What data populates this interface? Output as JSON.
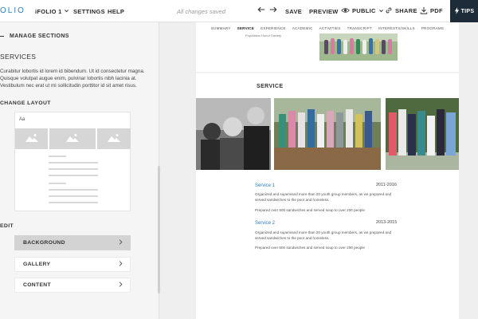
{
  "topbar": {
    "logo": "OLIO",
    "folio_label": "iFOLIO 1",
    "settings": "SETTINGS",
    "help": "HELP",
    "saved_status": "All changes saved",
    "save": "SAVE",
    "preview": "PREVIEW",
    "public": "PUBLIC",
    "share": "SHARE",
    "pdf": "PDF",
    "tips": "TIPS"
  },
  "sidebar": {
    "manage_sections": "MANAGE SECTIONS",
    "section_title": "SERVICES",
    "description": "Curabitur lobortis id lorem id bibendum. Ut id consectetur magna. Quisque volutpat augue enim, pulvinar lobortis nibh lacinia at. Vestibulum nec erat ut mi sollicitudin porttitor id sit amet risus.",
    "change_layout": "CHANGE LAYOUT",
    "layout_preview_label": "Aa",
    "edit_heading": "EDIT",
    "edit_items": [
      {
        "label": "BACKGROUND",
        "active": true
      },
      {
        "label": "GALLERY",
        "active": false
      },
      {
        "label": "CONTENT",
        "active": false
      }
    ]
  },
  "main": {
    "nav": [
      "SUMMARY",
      "SERVICE",
      "EXPERIENCE",
      "ACADEMIC",
      "ACTIVITIES",
      "TRANSCRIPT",
      "INTERESTS/SKILLS",
      "PROGRAMS"
    ],
    "nav_active": "SERVICE",
    "org_text": "Population Honor Society",
    "service_heading": "SERVICE",
    "entries": [
      {
        "title": "Service 1",
        "years": "2011-2016",
        "line1": "Organized and supervised more than 20 youth group members, as we prepared and served sandwiches to the poor and homeless.",
        "line2": "Prepared over 800 sandwiches and served soup to over 200 people"
      },
      {
        "title": "Service 2",
        "years": "2013-2015",
        "line1": "Organized and supervised more than 20 youth group members, as we prepared and served sandwiches to the poor and homeless.",
        "line2": "Prepared over 800 sandwiches and served soup to over 200 people"
      }
    ]
  },
  "colors": {
    "accent": "#2a7fc1",
    "tips_bg": "#1e2c3a",
    "active_button": "#d3d3d3"
  },
  "icons": [
    "chevron-down-icon",
    "arrow-left-icon",
    "arrow-right-icon",
    "eye-icon",
    "share-icon",
    "download-icon",
    "bolt-icon",
    "chevron-right-icon",
    "image-icon"
  ]
}
